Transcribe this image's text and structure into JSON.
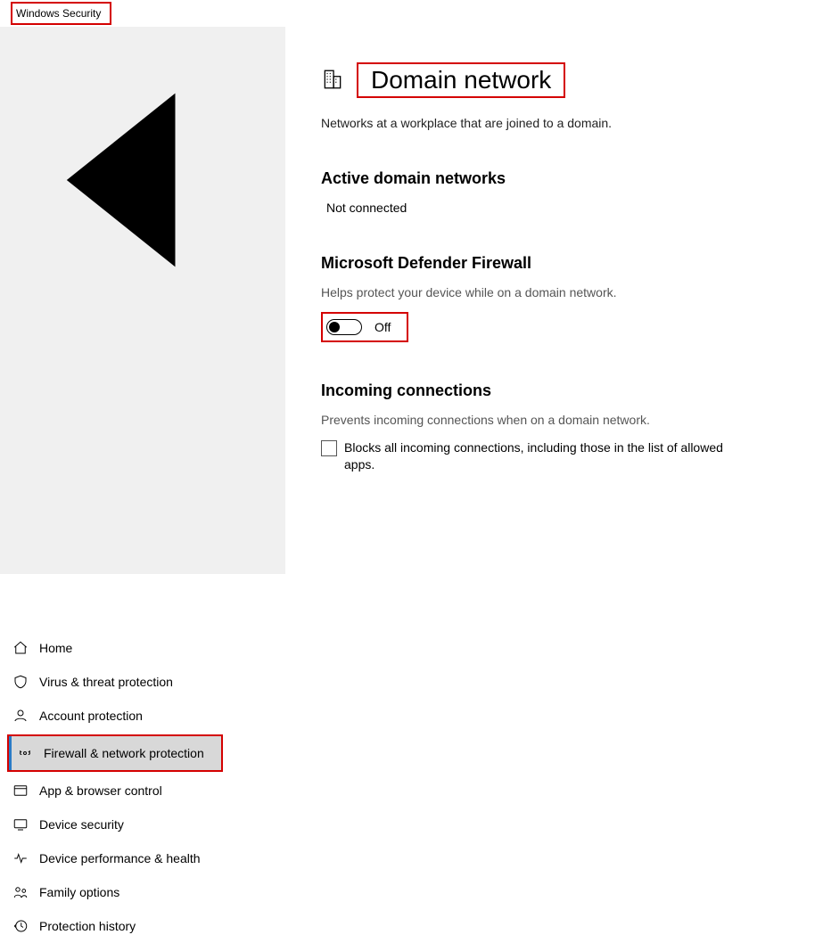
{
  "window": {
    "title": "Windows Security"
  },
  "sidebar": {
    "items": [
      {
        "label": "Home"
      },
      {
        "label": "Virus & threat protection"
      },
      {
        "label": "Account protection"
      },
      {
        "label": "Firewall & network protection"
      },
      {
        "label": "App & browser control"
      },
      {
        "label": "Device security"
      },
      {
        "label": "Device performance & health"
      },
      {
        "label": "Family options"
      },
      {
        "label": "Protection history"
      }
    ]
  },
  "page": {
    "title": "Domain network",
    "subtitle": "Networks at a workplace that are joined to a domain."
  },
  "active_networks": {
    "heading": "Active domain networks",
    "status": "Not connected"
  },
  "firewall": {
    "heading": "Microsoft Defender Firewall",
    "help": "Helps protect your device while on a domain network.",
    "state_label": "Off"
  },
  "incoming": {
    "heading": "Incoming connections",
    "help": "Prevents incoming connections when on a domain network.",
    "checkbox_label": "Blocks all incoming connections, including those in the list of allowed apps."
  }
}
